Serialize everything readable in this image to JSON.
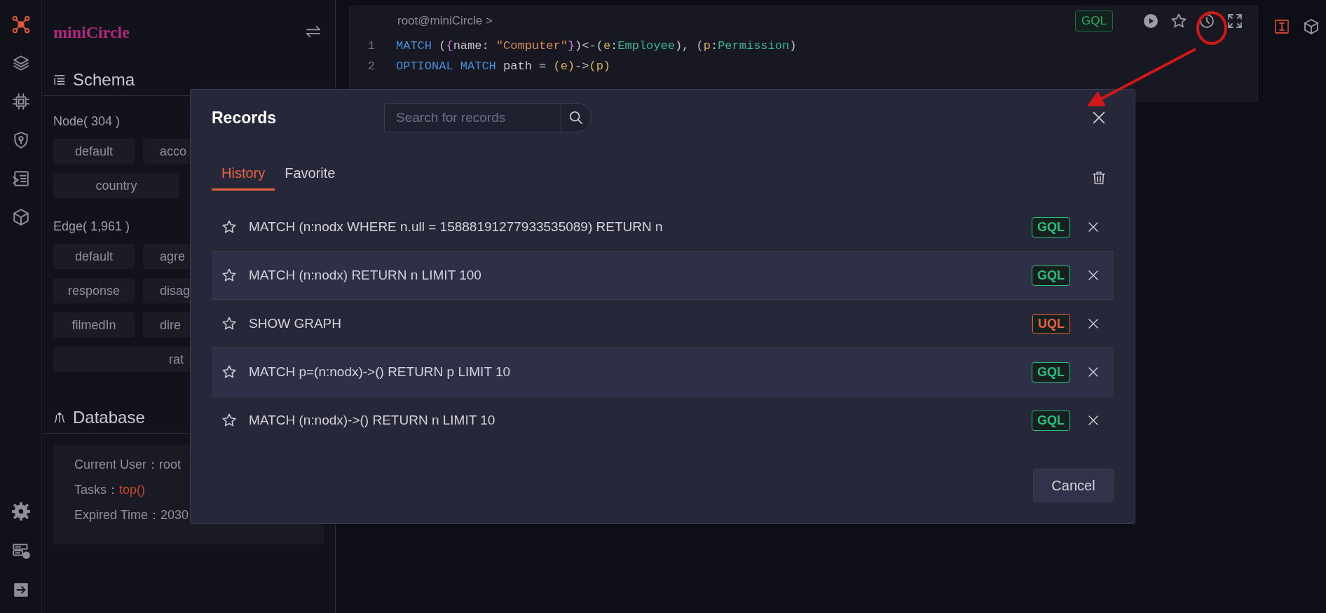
{
  "rail": {
    "items": [
      {
        "kind": "network",
        "selected": true
      },
      {
        "kind": "layers",
        "selected": false
      },
      {
        "kind": "chip",
        "selected": false
      },
      {
        "kind": "shield",
        "selected": false
      },
      {
        "kind": "inbox",
        "selected": false
      },
      {
        "kind": "cube",
        "selected": false
      }
    ],
    "bottom": [
      {
        "kind": "settings"
      },
      {
        "kind": "server"
      },
      {
        "kind": "exit"
      }
    ]
  },
  "sidebar": {
    "logo": "miniCircle",
    "schema": {
      "title": "Schema",
      "node_label": "Node( 304 )",
      "node_tags": [
        [
          "default",
          "acco"
        ],
        [
          "country"
        ]
      ],
      "edge_label": "Edge( 1,961 )",
      "edge_tags": [
        [
          "default",
          "agre"
        ],
        [
          "response",
          "disag"
        ],
        [
          "filmedIn",
          "dire"
        ],
        [
          "rat"
        ]
      ]
    },
    "database": {
      "title": "Database",
      "info": [
        {
          "label": "Current User：",
          "value": "root",
          "kind": "plain"
        },
        {
          "label": "Tasks：",
          "value": "top()",
          "kind": "link"
        },
        {
          "label": "Expired Time：",
          "value": "2030",
          "kind": "plain"
        }
      ]
    }
  },
  "editor": {
    "prompt": "root@miniCircle >",
    "language": "GQL",
    "lines": [
      {
        "number": "1",
        "tokens": [
          {
            "kind": "keyword",
            "text": "MATCH"
          },
          {
            "kind": "plain",
            "text": " ("
          },
          {
            "kind": "brace",
            "text": "{"
          },
          {
            "kind": "plain",
            "text": "name: "
          },
          {
            "kind": "string",
            "text": "\"Computer\""
          },
          {
            "kind": "brace",
            "text": "}"
          },
          {
            "kind": "plain",
            "text": ")<-("
          },
          {
            "kind": "var",
            "text": "e"
          },
          {
            "kind": "plain",
            "text": ":"
          },
          {
            "kind": "label",
            "text": "Employee"
          },
          {
            "kind": "plain",
            "text": "), ("
          },
          {
            "kind": "var",
            "text": "p"
          },
          {
            "kind": "plain",
            "text": ":"
          },
          {
            "kind": "label",
            "text": "Permission"
          },
          {
            "kind": "plain",
            "text": ")"
          }
        ]
      },
      {
        "number": "2",
        "tokens": [
          {
            "kind": "keyword",
            "text": "OPTIONAL MATCH"
          },
          {
            "kind": "plain",
            "text": " path = "
          },
          {
            "kind": "var",
            "text": "(e)"
          },
          {
            "kind": "plain",
            "text": "->"
          },
          {
            "kind": "var",
            "text": "(p)"
          }
        ]
      }
    ]
  },
  "modal": {
    "title": "Records",
    "search": {
      "placeholder": "Search for records"
    },
    "tabs": [
      {
        "label": "History",
        "selected": true
      },
      {
        "label": "Favorite",
        "selected": false
      }
    ],
    "records": [
      {
        "query": "MATCH (n:nodx WHERE n.ull = 15888191277933535089) RETURN n",
        "language": "GQL",
        "color": "#27c07d"
      },
      {
        "query": "MATCH (n:nodx) RETURN n LIMIT 100",
        "language": "GQL",
        "color": "#27c07d"
      },
      {
        "query": "SHOW GRAPH",
        "language": "UQL",
        "color": "#e8643c"
      },
      {
        "query": "MATCH p=(n:nodx)->() RETURN p LIMIT 10",
        "language": "GQL",
        "color": "#27c07d"
      },
      {
        "query": "MATCH (n:nodx)->() RETURN n LIMIT 10",
        "language": "GQL",
        "color": "#27c07d"
      }
    ],
    "cancel": "Cancel"
  }
}
